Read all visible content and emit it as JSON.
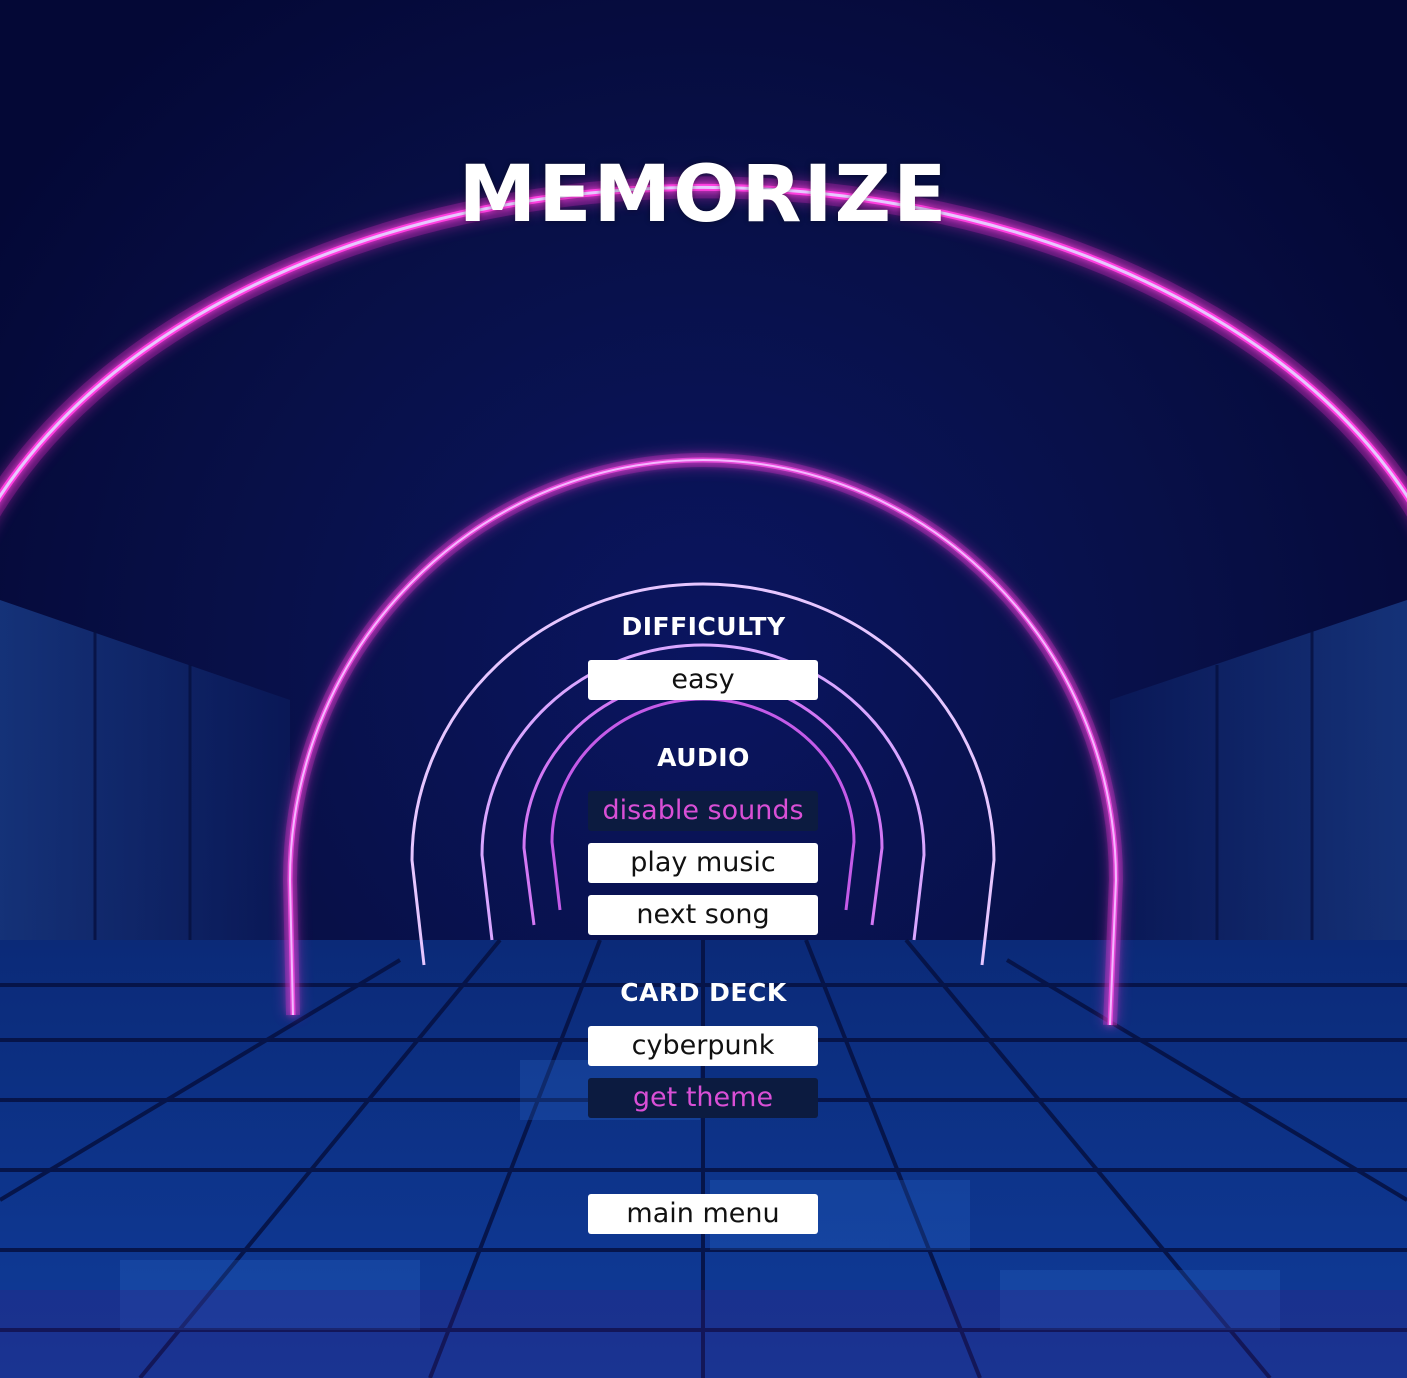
{
  "app": {
    "title": "MEMORIZE"
  },
  "difficulty": {
    "label": "DIFFICULTY",
    "value": "easy"
  },
  "audio": {
    "label": "AUDIO",
    "disable_sounds": "disable sounds",
    "play_music": "play music",
    "next_song": "next song"
  },
  "card_deck": {
    "label": "CARD DECK",
    "deck": "cyberpunk",
    "get_theme": "get theme"
  },
  "nav": {
    "main_menu": "main menu"
  },
  "colors": {
    "neon_pink": "#ff2fd8",
    "background": "#05093a",
    "highlight_text": "#d94fd6",
    "highlight_bg": "#0c1b40"
  }
}
